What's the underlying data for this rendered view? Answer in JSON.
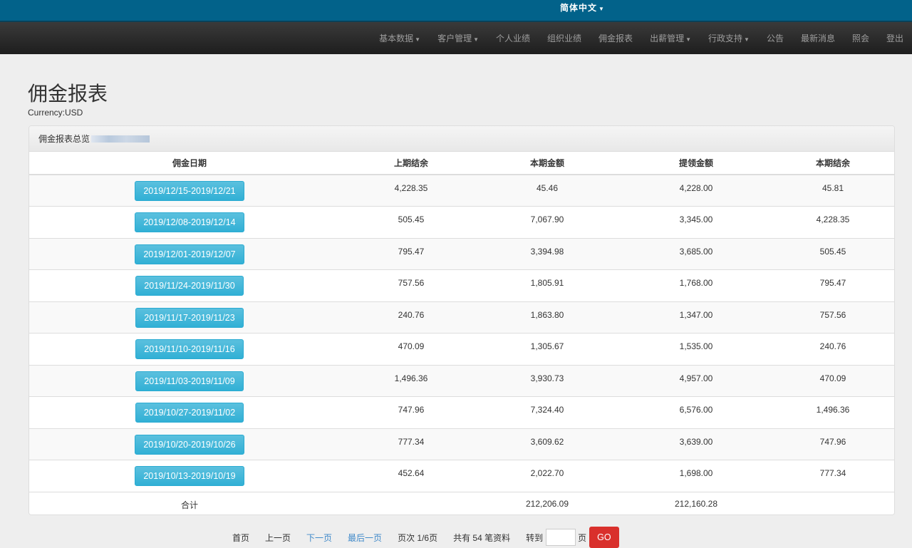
{
  "header": {
    "language": "简体中文"
  },
  "nav": [
    {
      "label": "基本数据",
      "dropdown": true
    },
    {
      "label": "客户管理",
      "dropdown": true
    },
    {
      "label": "个人业绩",
      "dropdown": false
    },
    {
      "label": "组织业绩",
      "dropdown": false
    },
    {
      "label": "佣金报表",
      "dropdown": false
    },
    {
      "label": "出薪管理",
      "dropdown": true
    },
    {
      "label": "行政支持",
      "dropdown": true
    },
    {
      "label": "公告",
      "dropdown": false
    },
    {
      "label": "最新消息",
      "dropdown": false
    },
    {
      "label": "照会",
      "dropdown": false
    },
    {
      "label": "登出",
      "dropdown": false
    }
  ],
  "page": {
    "title": "佣金报表",
    "currency": "Currency:USD",
    "panel_title": "佣金报表总览"
  },
  "table": {
    "columns": [
      "佣金日期",
      "上期结余",
      "本期金额",
      "提领金额",
      "本期结余"
    ],
    "rows": [
      [
        "2019/12/15-2019/12/21",
        "4,228.35",
        "45.46",
        "4,228.00",
        "45.81"
      ],
      [
        "2019/12/08-2019/12/14",
        "505.45",
        "7,067.90",
        "3,345.00",
        "4,228.35"
      ],
      [
        "2019/12/01-2019/12/07",
        "795.47",
        "3,394.98",
        "3,685.00",
        "505.45"
      ],
      [
        "2019/11/24-2019/11/30",
        "757.56",
        "1,805.91",
        "1,768.00",
        "795.47"
      ],
      [
        "2019/11/17-2019/11/23",
        "240.76",
        "1,863.80",
        "1,347.00",
        "757.56"
      ],
      [
        "2019/11/10-2019/11/16",
        "470.09",
        "1,305.67",
        "1,535.00",
        "240.76"
      ],
      [
        "2019/11/03-2019/11/09",
        "1,496.36",
        "3,930.73",
        "4,957.00",
        "470.09"
      ],
      [
        "2019/10/27-2019/11/02",
        "747.96",
        "7,324.40",
        "6,576.00",
        "1,496.36"
      ],
      [
        "2019/10/20-2019/10/26",
        "777.34",
        "3,609.62",
        "3,639.00",
        "747.96"
      ],
      [
        "2019/10/13-2019/10/19",
        "452.64",
        "2,022.70",
        "1,698.00",
        "777.34"
      ]
    ],
    "total": {
      "label": "合计",
      "current": "212,206.09",
      "withdrawn": "212,160.28"
    }
  },
  "pager": {
    "first": "首页",
    "prev": "上一页",
    "next": "下一页",
    "last": "最后一页",
    "page_info": "页次 1/6页",
    "count": "共有 54 笔资料",
    "goto": "转到",
    "goto_value": "",
    "page_unit": "页",
    "go": "GO"
  }
}
